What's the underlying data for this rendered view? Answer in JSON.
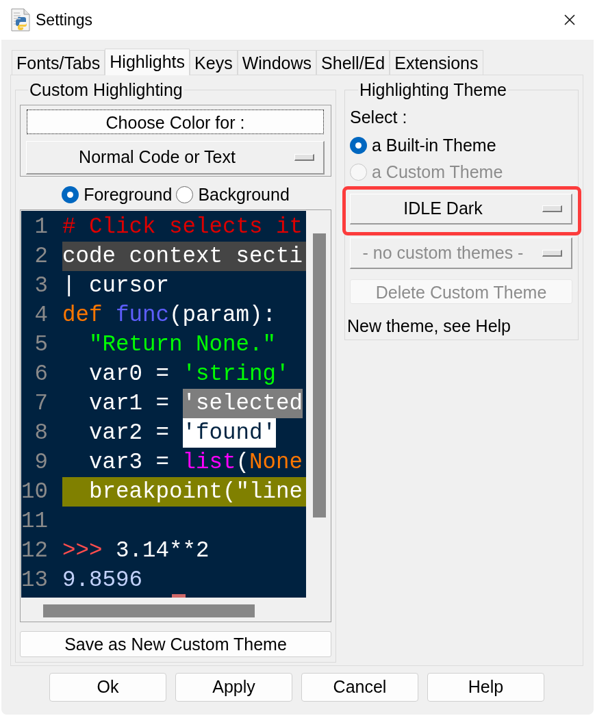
{
  "window": {
    "title": "Settings"
  },
  "tabs": [
    {
      "label": "Fonts/Tabs",
      "selected": false
    },
    {
      "label": "Highlights",
      "selected": true
    },
    {
      "label": "Keys",
      "selected": false
    },
    {
      "label": "Windows",
      "selected": false
    },
    {
      "label": "Shell/Ed",
      "selected": false
    },
    {
      "label": "Extensions",
      "selected": false
    }
  ],
  "custom_highlighting": {
    "title": "Custom Highlighting",
    "choose_color_button": {
      "label": "Choose Color for :",
      "focused": true
    },
    "element_menu": {
      "value": "Normal Code or Text"
    },
    "color_target": [
      {
        "label": "Foreground",
        "selected": true
      },
      {
        "label": "Background",
        "selected": false
      }
    ],
    "sample": {
      "lines": [
        {
          "number": "1",
          "kind": "normal",
          "segments": [
            {
              "text": "# Click selects it",
              "kind": "comment"
            }
          ]
        },
        {
          "number": "2",
          "kind": "context",
          "segments": [
            {
              "text": "code context secti",
              "kind": "normal"
            }
          ]
        },
        {
          "number": "3",
          "kind": "normal",
          "segments": [
            {
              "text": "| cursor",
              "kind": "normal"
            }
          ]
        },
        {
          "number": "4",
          "kind": "normal",
          "segments": [
            {
              "text": "def ",
              "kind": "keyword"
            },
            {
              "text": "func",
              "kind": "definition"
            },
            {
              "text": "(param):",
              "kind": "normal"
            }
          ]
        },
        {
          "number": "5",
          "kind": "normal",
          "segments": [
            {
              "text": "  \"Return None.\"",
              "kind": "string"
            }
          ]
        },
        {
          "number": "6",
          "kind": "normal",
          "segments": [
            {
              "text": "  var0 = ",
              "kind": "normal"
            },
            {
              "text": "'string'",
              "kind": "string"
            }
          ]
        },
        {
          "number": "7",
          "kind": "normal",
          "segments": [
            {
              "text": "  var1 = ",
              "kind": "normal"
            },
            {
              "text": "'selected",
              "kind": "selected"
            }
          ]
        },
        {
          "number": "8",
          "kind": "normal",
          "segments": [
            {
              "text": "  var2 = ",
              "kind": "normal"
            },
            {
              "text": "'found'",
              "kind": "found"
            }
          ]
        },
        {
          "number": "9",
          "kind": "normal",
          "segments": [
            {
              "text": "  var3 = ",
              "kind": "normal"
            },
            {
              "text": "list",
              "kind": "builtin"
            },
            {
              "text": "(",
              "kind": "normal"
            },
            {
              "text": "None",
              "kind": "keyword"
            }
          ]
        },
        {
          "number": "10",
          "kind": "breakpoint",
          "segments": [
            {
              "text": "  breakpoint(\"line",
              "kind": "normal"
            }
          ]
        },
        {
          "number": "11",
          "kind": "normal"
        },
        {
          "number": "12",
          "kind": "normal",
          "segments": [
            {
              "text": ">>>",
              "kind": "prompt"
            },
            {
              "text": " 3.14**2",
              "kind": "normal"
            }
          ]
        },
        {
          "number": "13",
          "kind": "normal",
          "segments": [
            {
              "text": "9.8596",
              "kind": "stdout"
            }
          ]
        }
      ]
    },
    "save_button": "Save as New Custom Theme"
  },
  "highlighting_theme": {
    "title": "Highlighting Theme",
    "select_label": "Select :",
    "theme_type": [
      {
        "label": "a Built-in Theme",
        "selected": true,
        "disabled": false
      },
      {
        "label": "a Custom Theme",
        "selected": false,
        "disabled": true
      }
    ],
    "builtin_menu": {
      "value": "IDLE Dark",
      "disabled": false,
      "highlighted": true
    },
    "custom_menu": {
      "value": "- no custom themes -",
      "disabled": true
    },
    "delete_button": {
      "label": "Delete Custom Theme",
      "disabled": true
    },
    "note": "New theme, see Help"
  },
  "buttons": [
    "Ok",
    "Apply",
    "Cancel",
    "Help"
  ]
}
